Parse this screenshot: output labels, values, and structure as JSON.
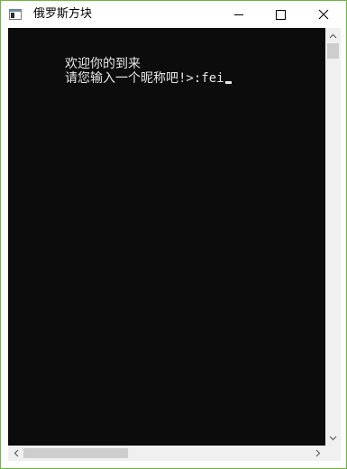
{
  "window": {
    "title": "俄罗斯方块"
  },
  "titlebar": {
    "minimize_icon": "minimize-icon",
    "maximize_icon": "maximize-icon",
    "close_icon": "close-icon"
  },
  "console": {
    "lines": [
      "欢迎你的到来",
      "请您输入一个昵称吧!>:fei"
    ],
    "background": "#0c0c0c",
    "foreground": "#e6e6e6"
  },
  "colors": {
    "window_border": "#6fb43f",
    "scrollbar_track": "#f0f0f0",
    "scrollbar_thumb": "#cdcdcd"
  }
}
